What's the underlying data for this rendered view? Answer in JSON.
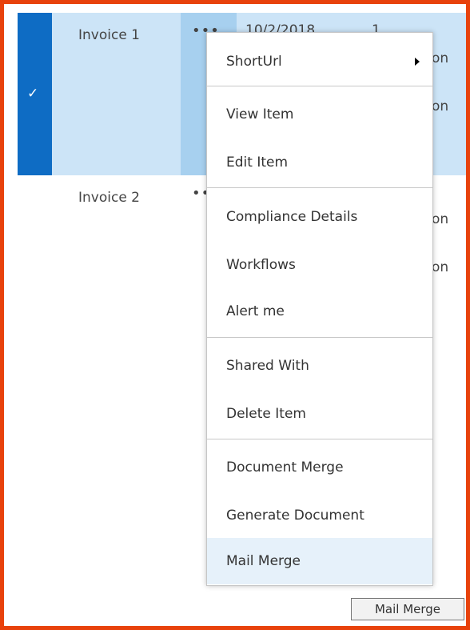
{
  "rows": [
    {
      "name": "Invoice 1",
      "date": "10/2/2018",
      "count": "1",
      "tail1": "on",
      "tail2": "on",
      "selected": true
    },
    {
      "name": "Invoice 2",
      "date": "",
      "count": "",
      "tail1": "on",
      "tail2": "on",
      "selected": false
    }
  ],
  "row1_dots": "•••",
  "row2_dots": "•••",
  "check_icon": "✓",
  "menu": {
    "shorturl": "ShortUrl",
    "view_item": "View Item",
    "edit_item": "Edit Item",
    "compliance_details": "Compliance Details",
    "workflows": "Workflows",
    "alert_me": "Alert me",
    "shared_with": "Shared With",
    "delete_item": "Delete Item",
    "document_merge": "Document Merge",
    "generate_document": "Generate Document",
    "mail_merge": "Mail Merge"
  },
  "tooltip": "Mail Merge",
  "colors": {
    "frame": "#e8420c",
    "selected_row": "#cce4f7",
    "check_column": "#0e6cc4",
    "menu_highlight": "#e6f1fa"
  }
}
